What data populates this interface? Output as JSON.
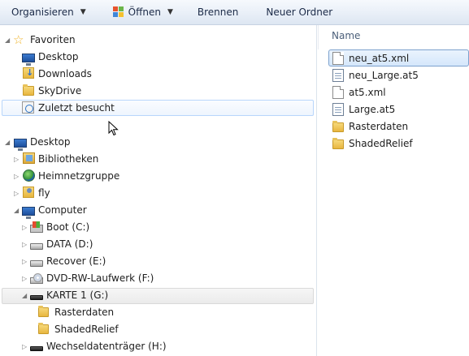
{
  "toolbar": {
    "organize": "Organisieren",
    "open": "Öffnen",
    "burn": "Brennen",
    "new_folder": "Neuer Ordner"
  },
  "nav": {
    "favorites": {
      "label": "Favoriten",
      "items": [
        {
          "label": "Desktop",
          "icon": "desktop-icon"
        },
        {
          "label": "Downloads",
          "icon": "downloads-folder-icon"
        },
        {
          "label": "SkyDrive",
          "icon": "folder-icon"
        },
        {
          "label": "Zuletzt besucht",
          "icon": "recent-places-icon"
        }
      ]
    },
    "desktop": {
      "label": "Desktop",
      "items": [
        {
          "label": "Bibliotheken",
          "icon": "libraries-icon"
        },
        {
          "label": "Heimnetzgruppe",
          "icon": "homegroup-icon"
        },
        {
          "label": "fly",
          "icon": "user-folder-icon"
        }
      ]
    },
    "computer": {
      "label": "Computer",
      "drives": [
        {
          "label": "Boot (C:)"
        },
        {
          "label": "DATA (D:)"
        },
        {
          "label": "Recover (E:)"
        },
        {
          "label": "DVD-RW-Laufwerk (F:)"
        },
        {
          "label": "KARTE 1 (G:)"
        },
        {
          "label": "Wechseldatenträger (H:)"
        }
      ],
      "karte_children": [
        {
          "label": "Rasterdaten"
        },
        {
          "label": "ShadedRelief"
        }
      ]
    }
  },
  "content": {
    "column_name": "Name",
    "files": [
      {
        "name": "neu_at5.xml",
        "type": "xml",
        "selected": true
      },
      {
        "name": "neu_Large.at5",
        "type": "at5",
        "selected": false
      },
      {
        "name": "at5.xml",
        "type": "xml",
        "selected": false
      },
      {
        "name": "Large.at5",
        "type": "at5",
        "selected": false
      },
      {
        "name": "Rasterdaten",
        "type": "folder",
        "selected": false
      },
      {
        "name": "ShadedRelief",
        "type": "folder",
        "selected": false
      }
    ]
  }
}
